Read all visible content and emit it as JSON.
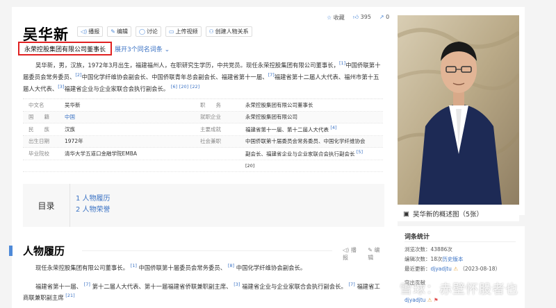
{
  "entry": {
    "title": "吴华新",
    "tools": [
      {
        "icon": "speaker-icon",
        "label": "播报"
      },
      {
        "icon": "edit-icon",
        "label": "编辑"
      },
      {
        "icon": "discuss-icon",
        "label": "讨论"
      },
      {
        "icon": "upload-icon",
        "label": "上传视频"
      },
      {
        "icon": "relation-icon",
        "label": "创建人物关系"
      }
    ],
    "collect_label": "收藏",
    "like_count": "395",
    "share_count": "0",
    "subtitle": "永荣控股集团有限公司董事长",
    "expand_label": "展开3个同名词条"
  },
  "summary": {
    "t1": "吴华新，男，汉族，1972年3月出生，福建福州人，在职研究生学历，中共党员。现任永荣控股集团有限公司董事长，",
    "r1": "[1]",
    "t2": "中国侨联第十届委员会常务委员、",
    "r2": "[2]",
    "t3": "中国化学纤维协会副会长、中国侨联青年总会副会长、福建省第十一届、",
    "r3": "[7]",
    "t4": "福建省第十二届人大代表、福州市第十五届人大代表、",
    "r4": "[3]",
    "t5": "福建省企业与企业家联合会执行副会长。",
    "r5": "[6]",
    "r6": "[20]",
    "r7": "[22]"
  },
  "info": [
    {
      "k1": "中文名",
      "v1": "吴华新",
      "k2": "职　　务",
      "v2": "永荣控股集团有限公司董事长"
    },
    {
      "k1": "国　　籍",
      "v1": "中国",
      "k2": "就职企业",
      "v2": "永荣控股集团有限公司"
    },
    {
      "k1": "民　　族",
      "v1": "汉族",
      "k2": "主要成就",
      "v2": "福建省第十一届、第十二届人大代表"
    },
    {
      "k1": "出生日期",
      "v1": "1972年",
      "k2": "社会兼职",
      "v2": "中国侨联第十届委员会常务委员、中国化学纤维协会"
    },
    {
      "k1": "毕业院校",
      "v1": "清华大学五道口金融学院EMBA",
      "k2": "",
      "v2": "副会长、福建省企业与企业家联合会执行副会长"
    },
    {
      "k1": "",
      "v1": "",
      "k2": "",
      "v2": "[20]"
    }
  ],
  "info_refs": {
    "r4": "[4]",
    "r5": "[5]"
  },
  "toc": {
    "label": "目录",
    "items": [
      "1  人物履历",
      "2  人物荣誉"
    ]
  },
  "section": {
    "title": "人物履历",
    "speak_label": "播报",
    "edit_label": "编辑",
    "p1_text": "现任永荣控股集团有限公司董事长。",
    "p1_r1": "[1]",
    "p1_text2": "中国侨联第十届委员会常务委员、",
    "p1_r2": "[8]",
    "p1_text3": "中国化学纤维协会副会长。",
    "p2_text": "福建省第十一届、",
    "p2_r1": "[7]",
    "p2_text2": "第十二届人大代表、第十一届福建省侨联兼职副主席、",
    "p2_r2": "[3]",
    "p2_text3": "福建省企业与企业家联合会执行副会长。",
    "p2_r3": "[7]",
    "p2_text4": "福建省工商联兼职副主席",
    "p2_r4": "[21]"
  },
  "photo": {
    "caption": "吴华新的概述图（5张）"
  },
  "stats": {
    "title": "词条统计",
    "views_label": "浏览次数：",
    "views": "43886次",
    "edits_label": "编辑次数：",
    "edits": "18次",
    "history_link": "历史版本",
    "updated_label": "最近更新：",
    "updated_user": "djyadjtu",
    "updated_date": "（2023-08-18）",
    "creator_label": "突出贡献",
    "creator_user": "djyadjtu"
  },
  "watermark": "雪球：赤壁怀股者也"
}
